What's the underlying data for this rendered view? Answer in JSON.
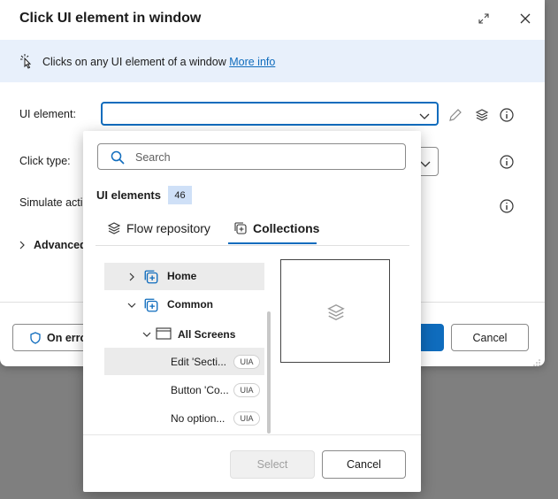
{
  "dialog": {
    "title": "Click UI element in window",
    "info_text": "Clicks on any UI element of a window",
    "info_link": "More info",
    "fields": {
      "ui_element_label": "UI element:",
      "ui_element_value": "",
      "click_type_label": "Click type:",
      "simulate_label": "Simulate actio"
    },
    "advanced_label": "Advanced",
    "footer": {
      "on_error_label": "On erro",
      "cancel_label": "Cancel"
    }
  },
  "popup": {
    "search_placeholder": "Search",
    "header_label": "UI elements",
    "count": "46",
    "tabs": [
      {
        "label": "Flow repository"
      },
      {
        "label": "Collections"
      }
    ],
    "tree": [
      {
        "label": "Home"
      },
      {
        "label": "Common"
      },
      {
        "label": "All Screens"
      }
    ],
    "elements": [
      {
        "label": "Edit 'Secti...",
        "badge": "UIA"
      },
      {
        "label": "Button 'Co...",
        "badge": "UIA"
      },
      {
        "label": "No option...",
        "badge": "UIA"
      }
    ],
    "select_label": "Select",
    "cancel_label": "Cancel"
  },
  "colors": {
    "accent": "#0f6cbd",
    "info_bar": "#e8f0fb",
    "badge_bg": "#cfe0f7"
  }
}
